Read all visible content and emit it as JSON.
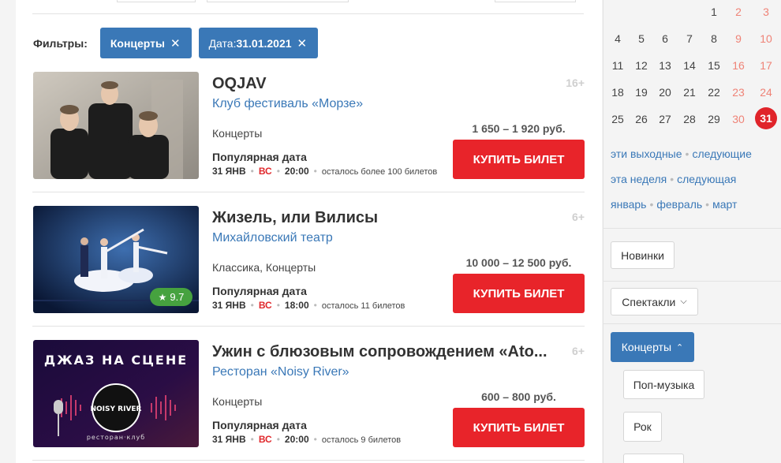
{
  "filters": {
    "label": "Фильтры:",
    "chips": [
      {
        "prefix": "",
        "value": "Концерты",
        "close": "✕"
      },
      {
        "prefix": "Дата: ",
        "value": "31.01.2021",
        "close": "✕"
      }
    ]
  },
  "events": [
    {
      "title": "OQJAV",
      "venue": "Клуб фестиваль «Морзе»",
      "age": "16+",
      "genre": "Концерты",
      "popular": "Популярная дата",
      "date": "31 ЯНВ",
      "dow": "ВС",
      "time": "20:00",
      "left": "осталось более 100 билетов",
      "price": "1 650 – 1 920 руб.",
      "buy": "КУПИТЬ БИЛЕТ"
    },
    {
      "title": "Жизель, или Вилисы",
      "venue": "Михайловский театр",
      "age": "6+",
      "genre": "Классика, Концерты",
      "popular": "Популярная дата",
      "date": "31 ЯНВ",
      "dow": "ВС",
      "time": "18:00",
      "left": "осталось 11 билетов",
      "price": "10 000 – 12 500 руб.",
      "buy": "КУПИТЬ БИЛЕТ",
      "rating": "9.7"
    },
    {
      "title": "Ужин с блюзовым сопровождением «Ato...",
      "venue": "Ресторан «Noisy River»",
      "age": "6+",
      "genre": "Концерты",
      "popular": "Популярная дата",
      "date": "31 ЯНВ",
      "dow": "ВС",
      "time": "20:00",
      "left": "осталось 9 билетов",
      "price": "600 – 800 руб.",
      "buy": "КУПИТЬ БИЛЕТ",
      "poster_title": "ДЖАЗ НА СЦЕНЕ",
      "poster_logo": "NOISY RIVER",
      "poster_sub": "ресторан·клуб"
    }
  ],
  "calendar": {
    "rows": [
      [
        null,
        null,
        null,
        null,
        "1",
        "2",
        "3"
      ],
      [
        "4",
        "5",
        "6",
        "7",
        "8",
        "9",
        "10"
      ],
      [
        "11",
        "12",
        "13",
        "14",
        "15",
        "16",
        "17"
      ],
      [
        "18",
        "19",
        "20",
        "21",
        "22",
        "23",
        "24"
      ],
      [
        "25",
        "26",
        "27",
        "28",
        "29",
        "30",
        "31"
      ]
    ],
    "today": "31"
  },
  "quick_links": [
    [
      "эти выходные",
      "следующие"
    ],
    [
      "эта неделя",
      "следующая"
    ],
    [
      "январь",
      "февраль",
      "март"
    ]
  ],
  "sidebar": {
    "new_label": "Новинки",
    "shows_label": "Спектакли",
    "concerts_label": "Концерты",
    "sub": [
      "Поп-музыка",
      "Рок"
    ]
  },
  "colors": {
    "accent": "#3a78b7",
    "buy": "#e8242a",
    "weekend": "#ef8377",
    "rating": "#46a23f"
  }
}
